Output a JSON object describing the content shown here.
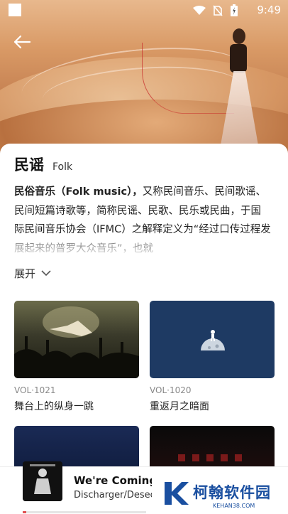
{
  "status_bar": {
    "time": "9:49"
  },
  "genre": {
    "title_cn": "民谣",
    "title_en": "Folk",
    "description_bold": "民俗音乐（Folk music），",
    "description_rest": "又称民间音乐、民间歌谣、民间短篇诗歌等，简称民谣、民歌、民乐或民曲，于国际民间音乐协会（IFMC）之解释定义为“经过口传过程发展起来的普罗大众音乐”，也就",
    "expand_label": "展开"
  },
  "albums": [
    {
      "vol": "VOL·1021",
      "title": "舞台上的纵身一跳",
      "image": "concert-crowd"
    },
    {
      "vol": "VOL·1020",
      "title": "重返月之暗面",
      "image": "astronaut-moon"
    },
    {
      "vol": "",
      "title": "",
      "image": "blue-stage"
    },
    {
      "vol": "",
      "title": "",
      "image": "dark-theater"
    }
  ],
  "player": {
    "song": "We're Coming To You",
    "artist": "Discharger/Desecration",
    "progress": 0.03
  },
  "watermark": {
    "text": "柯翰软件园",
    "sub": "KEHAN38.COM"
  },
  "colors": {
    "accent": "#e05050",
    "watermark": "#1a4fa0"
  }
}
